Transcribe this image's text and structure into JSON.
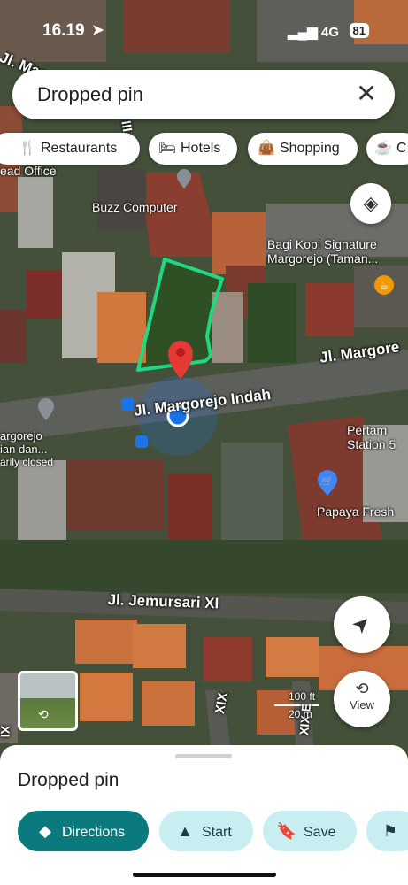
{
  "status_bar": {
    "time": "16.19",
    "network": "4G",
    "battery": "81"
  },
  "search": {
    "query": "Dropped pin"
  },
  "chips": [
    {
      "label": "Restaurants",
      "icon": "fork-knife-icon"
    },
    {
      "label": "Hotels",
      "icon": "bed-icon"
    },
    {
      "label": "Shopping",
      "icon": "shopping-bag-icon"
    },
    {
      "label": "C",
      "icon": "coffee-icon"
    }
  ],
  "map": {
    "places": {
      "head_office": "ead Office",
      "buzz": "Buzz Computer",
      "bagi_line1": "Bagi Kopi Signature",
      "bagi_line2": "Margorejo (Taman...",
      "margorejo_line1": "argorejo",
      "margorejo_line2": "ian dan...",
      "margorejo_line3": "arily closed",
      "pertamina_line1": "Pertam",
      "pertamina_line2": "Station 5",
      "papaya": "Papaya Fresh"
    },
    "roads": {
      "margorejo_indah": "Jl. Margorejo Indah",
      "margorejo_right": "Jl. Margore",
      "margorejo_top": "Jl. Marg",
      "jemursari": "Jl. Jemursari XI",
      "xix_a": "XIX",
      "xix_b": "XIX E",
      "xi_left": "XI",
      "iii": "III"
    },
    "scale": {
      "ft": "100 ft",
      "m": "20 m"
    },
    "view_label": "View",
    "colors": {
      "boundary": "#1fd882",
      "pin": "#e53935",
      "location_dot": "#1a73e8"
    }
  },
  "sheet": {
    "title": "Dropped pin",
    "buttons": [
      {
        "label": "Directions",
        "icon": "directions-icon"
      },
      {
        "label": "Start",
        "icon": "navigation-arrow-icon"
      },
      {
        "label": "Save",
        "icon": "bookmark-icon"
      },
      {
        "label": "",
        "icon": "flag-icon"
      }
    ]
  }
}
